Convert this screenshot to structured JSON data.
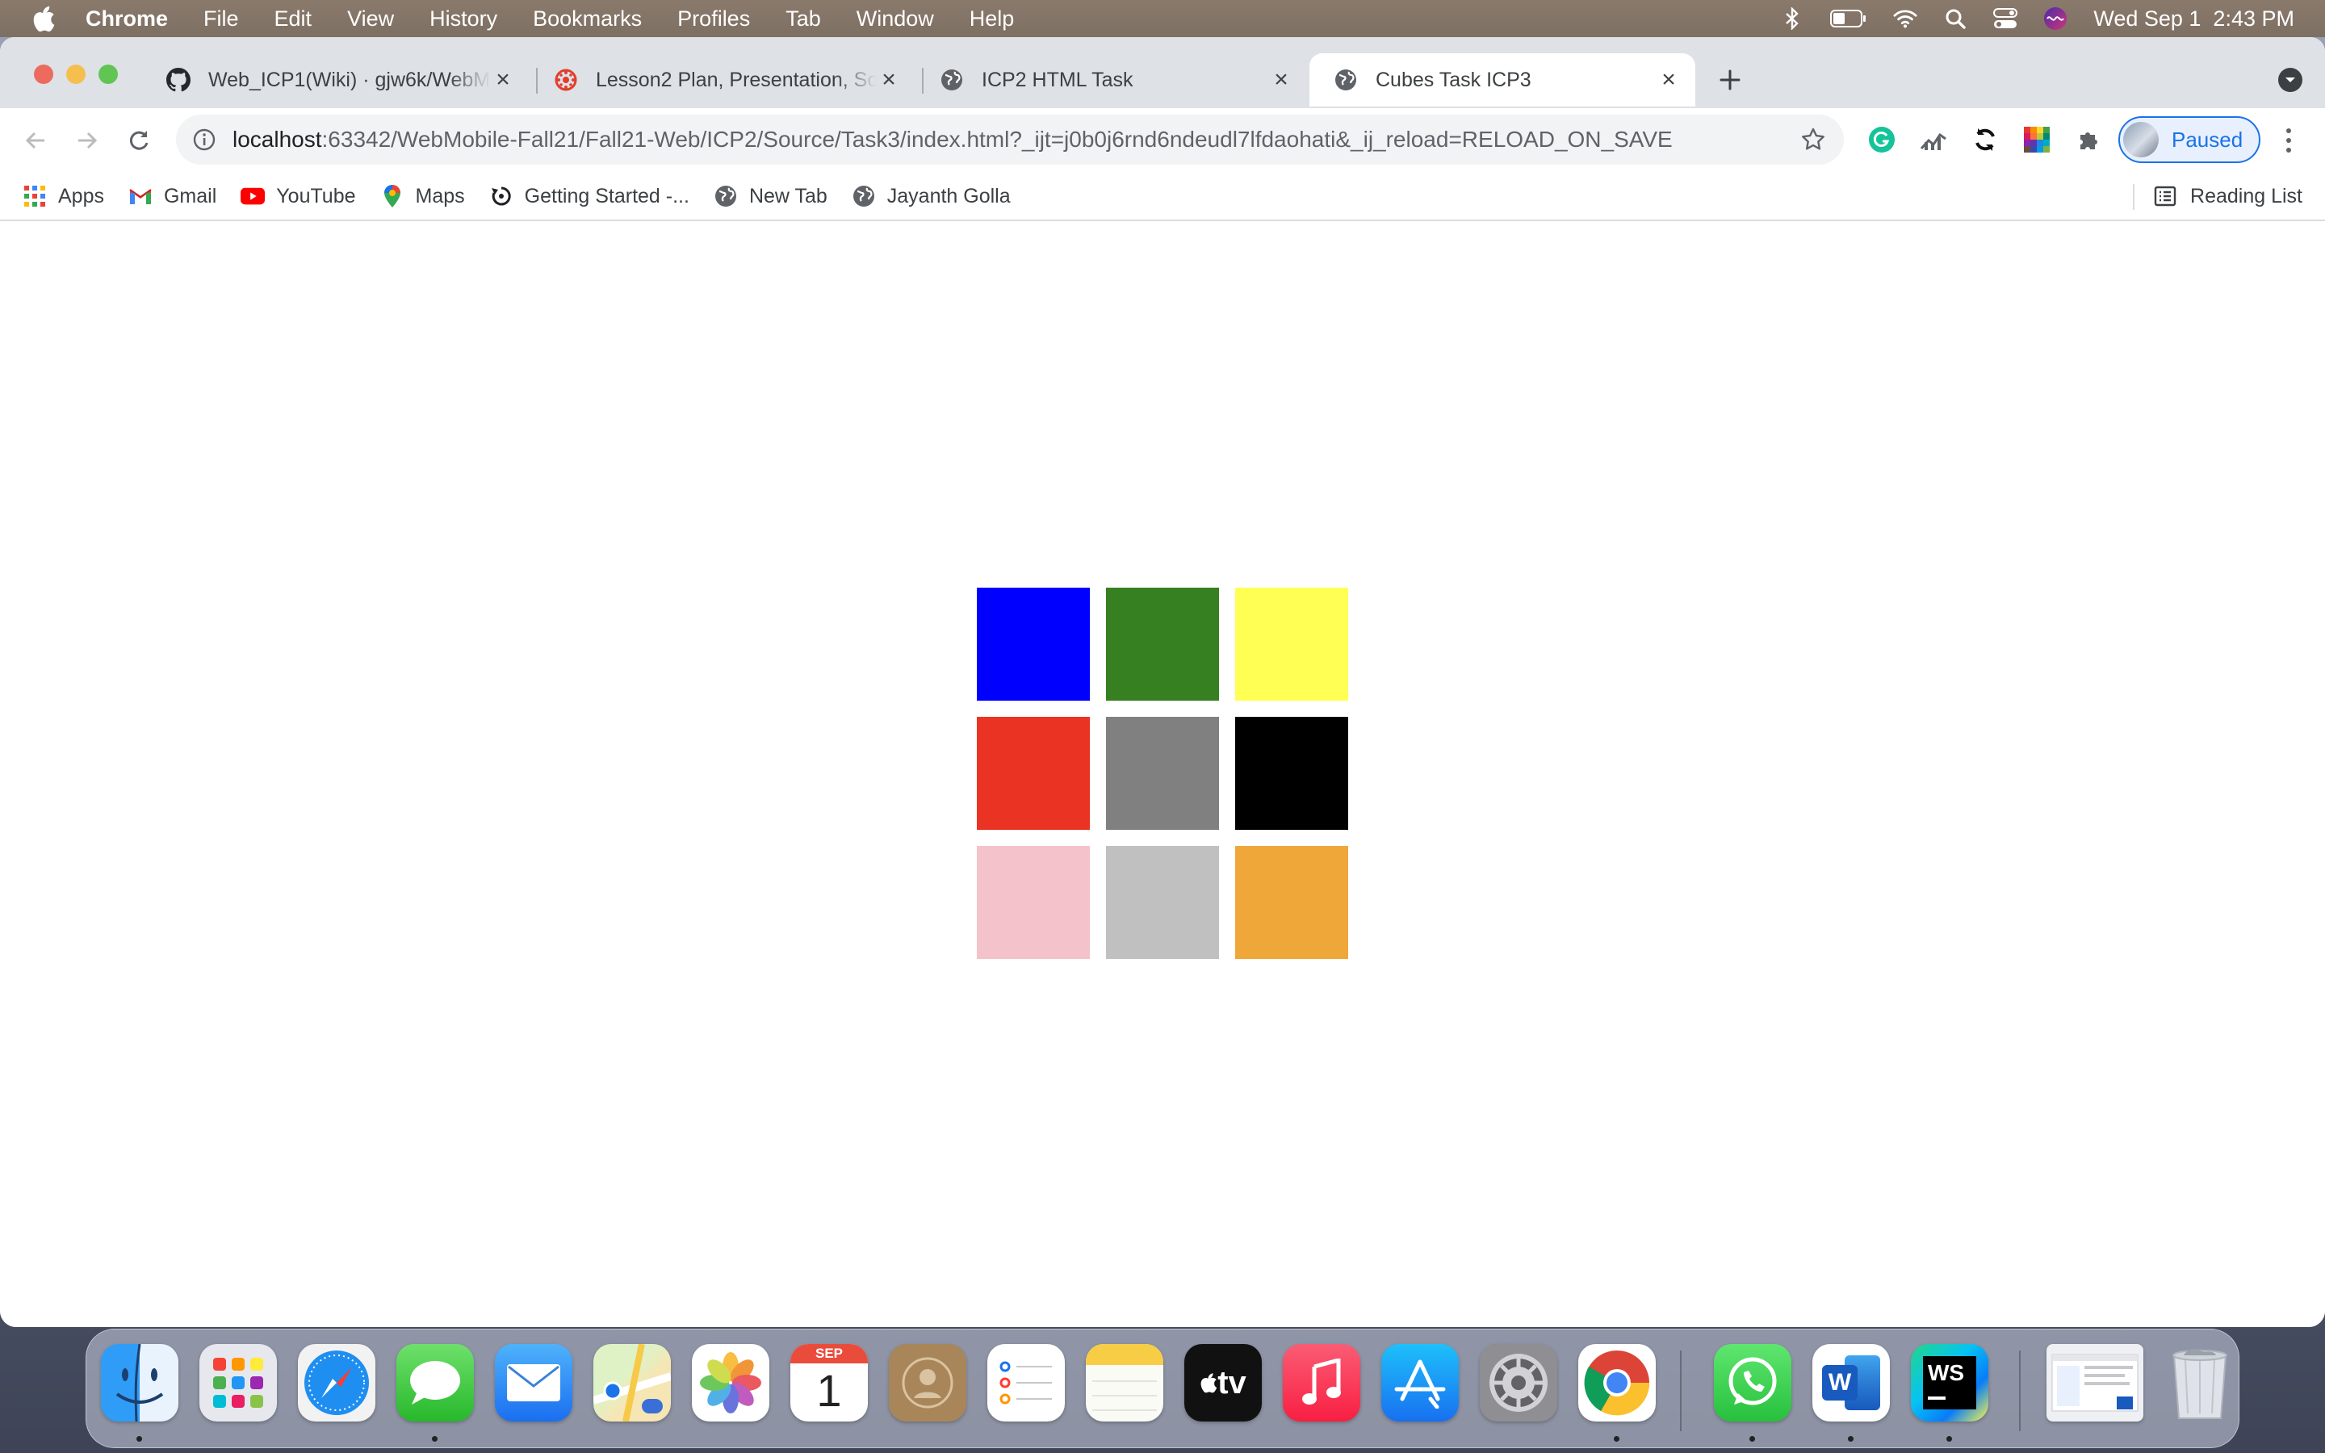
{
  "menubar": {
    "app_name": "Chrome",
    "menus": [
      "File",
      "Edit",
      "View",
      "History",
      "Bookmarks",
      "Profiles",
      "Tab",
      "Window",
      "Help"
    ],
    "datetime": "Wed Sep 1  2:43 PM"
  },
  "tabs": [
    {
      "title": "Web_ICP1(Wiki) · gjw6k/WebM",
      "favicon": "github-icon",
      "active": false
    },
    {
      "title": "Lesson2 Plan, Presentation, So",
      "favicon": "canvas-icon",
      "active": false
    },
    {
      "title": "ICP2 HTML Task",
      "favicon": "globe-icon",
      "active": false
    },
    {
      "title": "Cubes Task ICP3",
      "favicon": "globe-icon",
      "active": true
    }
  ],
  "toolbar": {
    "url_host": "localhost",
    "url_rest": ":63342/WebMobile-Fall21/Fall21-Web/ICP2/Source/Task3/index.html?_ijt=j0b0j6rnd6ndeudl7lfdaohati&_ij_reload=RELOAD_ON_SAVE",
    "profile_label": "Paused"
  },
  "bookmarks": [
    {
      "label": "Apps",
      "icon": "apps-grid-icon"
    },
    {
      "label": "Gmail",
      "icon": "gmail-icon"
    },
    {
      "label": "YouTube",
      "icon": "youtube-icon"
    },
    {
      "label": "Maps",
      "icon": "maps-pin-icon"
    },
    {
      "label": "Getting Started -...",
      "icon": "getting-started-icon"
    },
    {
      "label": "New Tab",
      "icon": "globe-icon"
    },
    {
      "label": "Jayanth Golla",
      "icon": "globe-icon"
    }
  ],
  "reading_list_label": "Reading List",
  "cubes": [
    {
      "color": "#0000ff"
    },
    {
      "color": "#368021"
    },
    {
      "color": "#ffff54"
    },
    {
      "color": "#ea3323"
    },
    {
      "color": "#808080"
    },
    {
      "color": "#000000"
    },
    {
      "color": "#f4c2cb"
    },
    {
      "color": "#c0c0c0"
    },
    {
      "color": "#f0a73a"
    }
  ],
  "dock": {
    "calendar_month": "SEP",
    "calendar_day": "1",
    "tv_label": "tv",
    "word_letter": "W",
    "webstorm_label": "WS",
    "apps": [
      "finder-icon",
      "launchpad-icon",
      "safari-icon",
      "messages-icon",
      "mail-icon",
      "maps-icon",
      "photos-icon",
      "calendar-icon",
      "contacts-icon",
      "reminders-icon",
      "notes-icon",
      "apple-tv-icon",
      "music-icon",
      "app-store-icon",
      "system-preferences-icon",
      "chrome-icon",
      "whatsapp-icon",
      "word-icon",
      "webstorm-icon",
      "window-preview-icon",
      "trash-icon"
    ]
  }
}
